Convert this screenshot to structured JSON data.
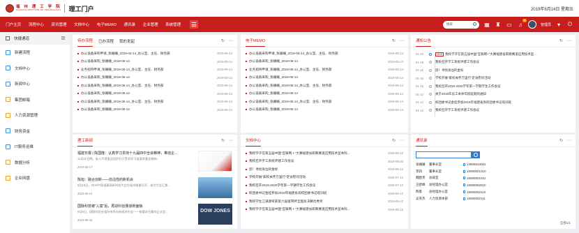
{
  "header": {
    "logo_cn": "福 州 理 工 学 院",
    "logo_en": "FUZHOU INSTITUTE OF TECHNOLOGY",
    "app_title": "理工门户",
    "date": "2019年6月14日 星期五"
  },
  "nav": {
    "items": [
      "门户主页",
      "流程中心",
      "资讯管理",
      "文档中心",
      "电子MEMO",
      "通讯录",
      "企业管理",
      "系统管理"
    ],
    "search_placeholder": "搜索",
    "badge": "10",
    "user": "管理员"
  },
  "sidebar": {
    "title": "快捷通道",
    "items": [
      {
        "label": "新建流程",
        "icon": "plus-doc-icon",
        "color": "#3a8ee6"
      },
      {
        "label": "文档中心",
        "icon": "doc-icon",
        "color": "#3a8ee6"
      },
      {
        "label": "新闻中心",
        "icon": "news-icon",
        "color": "#3a8ee6"
      },
      {
        "label": "集团邮箱",
        "icon": "mail-icon",
        "color": "#f0a020"
      },
      {
        "label": "人力资源管理",
        "icon": "people-icon",
        "color": "#f0a020"
      },
      {
        "label": "财务资金",
        "icon": "money-icon",
        "color": "#3a8ee6"
      },
      {
        "label": "IT服务运维",
        "icon": "it-icon",
        "color": "#3a8ee6"
      },
      {
        "label": "数据分析",
        "icon": "chart-icon",
        "color": "#f0a020"
      },
      {
        "label": "企业网盘",
        "icon": "cloud-icon",
        "color": "#f0a020"
      }
    ]
  },
  "workflow": {
    "tabs": [
      "待办流程",
      "已办流程",
      "我的发起"
    ],
    "rows": [
      {
        "text": "办公设备采购申请_张姗姗_2019-05-14_办公室、主任、财务部",
        "date": "2019-05-14"
      },
      {
        "text": "办公设备采购_张姗姗_2019-05-14",
        "date": "2019-05-14"
      },
      {
        "text": "业务招待申请_张姗姗_2019-05-14_办公室、主任、财务部",
        "date": "2019-05-14"
      },
      {
        "text": "办公设备采购_张姗姗_2019-05-14",
        "date": "2019-05-14"
      },
      {
        "text": "办公设备采购_张姗姗_2019-05-14_办公室、主任、财务部",
        "date": "2019-05-14"
      },
      {
        "text": "办公设备采购_张姗姗_2019-05-14",
        "date": "2019-05-14"
      },
      {
        "text": "办公设备采购_张姗姗_2019-05-14_办公室、主任、财务部",
        "date": "2019-05-14"
      },
      {
        "text": "办公设备采购_张姗姗_2019-05-14",
        "date": "2019-05-14"
      }
    ]
  },
  "memo": {
    "title": "电子MEMO",
    "rows": [
      {
        "text": "办公设备采购申请_张姗姗_2019-05-14_办公室、主任、财务部",
        "date": "2019-05-14"
      },
      {
        "text": "办公设备采购_张姗姗_2019-05-14",
        "date": "2019-05-14"
      },
      {
        "text": "业务招待申请_张姗姗_2019-05-14_办公室、主任、财务部",
        "date": "2019-05-14"
      },
      {
        "text": "办公设备采购_张姗姗_2019-05-14",
        "date": "2019-05-14"
      },
      {
        "text": "办公设备采购_张姗姗_2019-05-14_办公室、主任、财务部",
        "date": "2019-05-14"
      },
      {
        "text": "办公设备采购_张姗姗_2019-05-14",
        "date": "2019-05-14"
      },
      {
        "text": "办公设备采购_张姗姗_2019-05-14_办公室、主任、财务部",
        "date": "2019-05-14"
      },
      {
        "text": "办公设备采购_张姗姗_2019-05-14",
        "date": "2019-05-14"
      }
    ]
  },
  "notice": {
    "title": "通知公告",
    "rows": [
      {
        "date": "01-20",
        "new": "NEW",
        "text": "我校学子在第五届中国“互联网+”大赛福建省职教赛道应用技术型..."
      },
      {
        "date": "01-18",
        "new": "",
        "text": "我校召开学工系统评建工作会议"
      },
      {
        "date": "01-16",
        "new": "",
        "text": "思！寻找身边的金标"
      },
      {
        "date": "01-16",
        "new": "",
        "text": "学校开展“家校关怀万里行”走访慰问活动"
      },
      {
        "date": "01-15",
        "new": "",
        "text": "我校召开2019-2020学年第一学期学生工作会议"
      },
      {
        "date": "01-12",
        "new": "",
        "text": "关于2018年员工本体年假延期的通知"
      },
      {
        "date": "01-12",
        "new": "",
        "text": "校团委书记金挂参加2018年福建省高校团委书记培训班"
      },
      {
        "date": "01-12",
        "new": "",
        "text": "我校召开学工系统评建工作会议"
      }
    ]
  },
  "news": {
    "title": "理工新闻",
    "items": [
      {
        "title": "福建日报 | 陈国隆：认真学习贯彻十九届四中全会精神，推动企...",
        "desc": "11月10日晚，省人大常委会组织召开贯彻学习省委常委会精神...",
        "date": "2019-05-17",
        "thumb": "t1",
        "thumb_text": ""
      },
      {
        "title": "陈旭：融合创新——前沿性的新机会",
        "desc": "9月18日，2019中国福建高新科技大会在福州隆重召开，本次大会汇聚...",
        "date": "2019-05-14",
        "thumb": "t2",
        "thumb_text": ""
      },
      {
        "title": "国脉科技被“入富”后，再进科创赛道新面貌",
        "desc": "9月6日，国脉科技在福州市举办新闻发布会——按要求召集的正式会...",
        "date": "2019-05-15",
        "thumb": "t3",
        "thumb_text": "DOW JONES"
      }
    ]
  },
  "docs": {
    "title": "文档中心",
    "rows": [
      {
        "text": "我校学子在第五届中国“互联网＋”大赛福建省职教赛道应用技术型本科...",
        "date": "2019-05-12"
      },
      {
        "text": "我校召开学工系统评建工作会议",
        "date": "2019-05-20"
      },
      {
        "text": "思！寻找身边的金标",
        "date": "2019-05-12"
      },
      {
        "text": "学校开展“家校关怀万里行”走访慰问活动",
        "date": "2018-07-13"
      },
      {
        "text": "我校召开2019-2020学年第一学期学生工作会议",
        "date": "2018-07-13"
      },
      {
        "text": "校团委书记金挂参加2018年福建省高校团委书记培训班",
        "date": "2019-05-12"
      },
      {
        "text": "我校学生江满源荣获第六届富邦杯全国总决赛优秀奖",
        "date": "2019-05-12"
      },
      {
        "text": "我校学子在第五届中国“互联网＋”大赛福建省职教赛道应用技术型本科...",
        "date": "2019-05-12"
      }
    ]
  },
  "contacts": {
    "title": "通讯录",
    "count": "全部1/1",
    "rows": [
      {
        "name": "张姗姗",
        "dept": "董事长室",
        "phone": "13805910001"
      },
      {
        "name": "李四",
        "dept": "董事长室",
        "phone": "15000001010"
      },
      {
        "name": "魏欧贵",
        "dept": "总裁室",
        "phone": "15000001021"
      },
      {
        "name": "王欧峰",
        "dept": "总经理办公室",
        "phone": "15000002010"
      },
      {
        "name": "陶雷",
        "dept": "总经理办公室",
        "phone": "15000002110"
      },
      {
        "name": "吴英杰",
        "dept": "人力资源本部",
        "phone": "15000002111"
      }
    ]
  },
  "colors": {
    "brand": "#c81d1d",
    "accent": "#2d7bd4"
  }
}
